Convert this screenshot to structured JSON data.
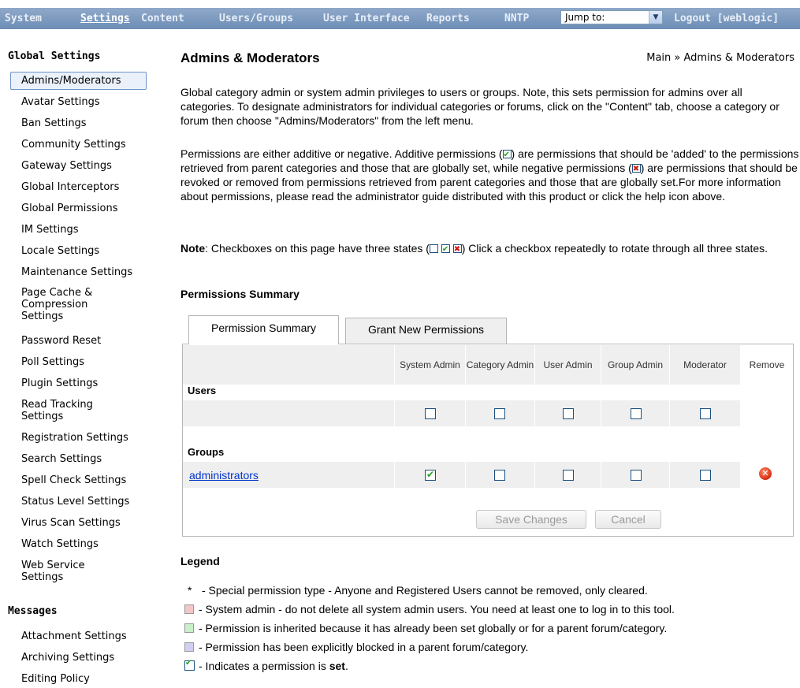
{
  "nav": {
    "items": [
      "System",
      "Settings",
      "Content",
      "Users/Groups",
      "User Interface",
      "Reports",
      "NNTP"
    ],
    "jump_label": "Jump to:",
    "logout": "Logout [weblogic]"
  },
  "sidebar": {
    "global_heading": "Global Settings",
    "global_items": [
      "Admins/Moderators",
      "Avatar Settings",
      "Ban Settings",
      "Community Settings",
      "Gateway Settings",
      "Global Interceptors",
      "Global Permissions",
      "IM Settings",
      "Locale Settings",
      "Maintenance Settings",
      "Page Cache & Compression Settings",
      "Password Reset",
      "Poll Settings",
      "Plugin Settings",
      "Read Tracking Settings",
      "Registration Settings",
      "Search Settings",
      "Spell Check Settings",
      "Status Level Settings",
      "Virus Scan Settings",
      "Watch Settings",
      "Web Service Settings"
    ],
    "messages_heading": "Messages",
    "messages_items": [
      "Attachment Settings",
      "Archiving Settings",
      "Editing Policy"
    ]
  },
  "page": {
    "title": "Admins & Moderators",
    "breadcrumb": "Main » Admins & Moderators",
    "intro": "Global category admin or system admin privileges to users or groups. Note, this sets permission for admins over all categories. To designate administrators for individual categories or forums, click on the \"Content\" tab, choose a category or forum then choose \"Admins/Moderators\" from the left menu.",
    "perm_p1": "Permissions are either additive or negative. Additive permissions (",
    "perm_p2": ") are permissions that should be 'added' to the permissions retrieved from parent categories and those that are globally set, while negative permissions (",
    "perm_p3": ") are permissions that should be revoked or removed from permissions retrieved from parent categories and those that are globally set.For more information about permissions, please read the administrator guide distributed with this product or click the help icon above.",
    "note_label": "Note",
    "note_p1": ": Checkboxes on this page have three states (",
    "note_p2": ") Click a checkbox repeatedly to rotate through all three states.",
    "summary_heading": "Permissions Summary"
  },
  "tabs": [
    "Permission Summary",
    "Grant New Permissions"
  ],
  "table": {
    "columns": [
      "System Admin",
      "Category Admin",
      "User Admin",
      "Group Admin",
      "Moderator",
      "Remove"
    ],
    "users_label": "Users",
    "groups_label": "Groups",
    "group_rows": [
      {
        "name": "administrators",
        "checks": [
          true,
          false,
          false,
          false,
          false
        ]
      }
    ],
    "user_row_checks": [
      false,
      false,
      false,
      false,
      false
    ]
  },
  "buttons": {
    "save": "Save Changes",
    "cancel": "Cancel"
  },
  "legend": {
    "heading": "Legend",
    "items": [
      {
        "marker": "*",
        "text": "- Special permission type - Anyone and Registered Users cannot be removed, only cleared."
      },
      {
        "color": "#f4c6c6",
        "text": "- System admin - do not delete all system admin users. You need at least one to log in to this tool."
      },
      {
        "color": "#c9efc9",
        "text": "- Permission is inherited because it has already been set globally or for a parent forum/category."
      },
      {
        "color": "#cfcff2",
        "text": "- Permission has been explicitly blocked in a parent forum/category."
      },
      {
        "text": "- Indicates a permission is ",
        "bold": "set",
        "tail": "."
      }
    ]
  }
}
